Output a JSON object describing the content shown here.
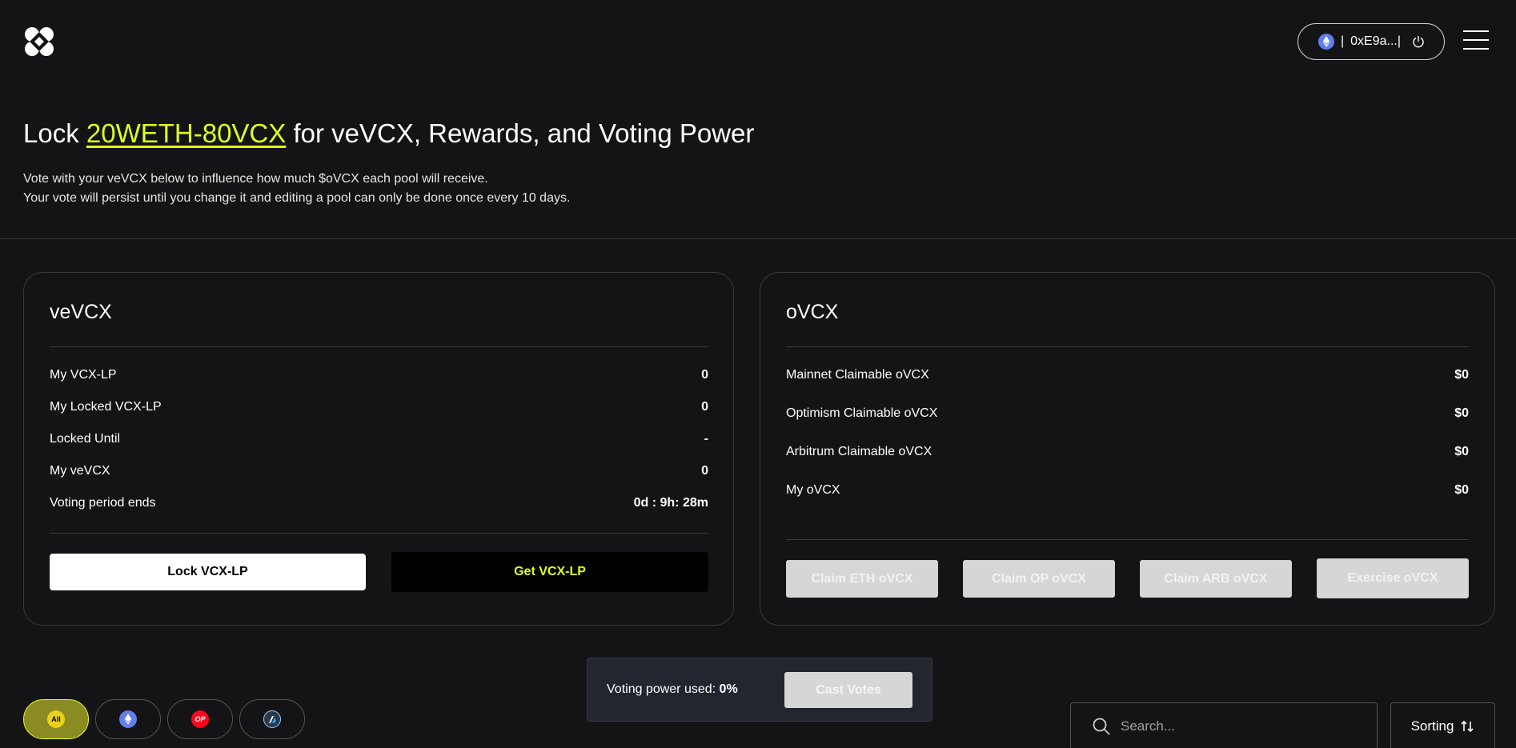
{
  "header": {
    "wallet": {
      "network_icon": "ethereum-icon",
      "separator": "|",
      "address": "0xE9a...|",
      "power_icon": "power-icon"
    },
    "menu_icon": "hamburger-menu-icon"
  },
  "hero": {
    "title_prefix": "Lock ",
    "title_lp": "20WETH-80VCX",
    "title_suffix": " for veVCX, Rewards, and Voting Power",
    "desc_line1": "Vote with your veVCX below to influence how much $oVCX each pool will receive.",
    "desc_line2": "Your vote will persist until you change it and editing a pool can only be done once every 10 days."
  },
  "vevcx_card": {
    "title": "veVCX",
    "rows": [
      {
        "label": "My VCX-LP",
        "value": "0"
      },
      {
        "label": "My Locked VCX-LP",
        "value": "0"
      },
      {
        "label": "Locked Until",
        "value": "-"
      },
      {
        "label": "My veVCX",
        "value": "0"
      },
      {
        "label": "Voting period ends",
        "value": "0d : 9h: 28m"
      }
    ],
    "lock_button": "Lock VCX-LP",
    "get_button": "Get VCX-LP"
  },
  "ovcx_card": {
    "title": "oVCX",
    "rows": [
      {
        "label": "Mainnet Claimable oVCX",
        "value": "$0"
      },
      {
        "label": "Optimism Claimable oVCX",
        "value": "$0"
      },
      {
        "label": "Arbitrum Claimable oVCX",
        "value": "$0"
      },
      {
        "label": "My oVCX",
        "value": "$0"
      }
    ],
    "buttons": [
      "Claim ETH oVCX",
      "Claim OP oVCX",
      "Claim ARB oVCX",
      "Exercise oVCX"
    ]
  },
  "voting": {
    "label": "Voting power used: ",
    "value": "0%",
    "cast_button": "Cast Votes"
  },
  "network_filters": [
    {
      "label": "All",
      "icon": "all-networks-icon",
      "active": true
    },
    {
      "label": "",
      "icon": "ethereum-icon",
      "active": false
    },
    {
      "label": "OP",
      "icon": "optimism-icon",
      "active": false
    },
    {
      "label": "",
      "icon": "arbitrum-icon",
      "active": false
    }
  ],
  "search": {
    "placeholder": "Search...",
    "icon": "search-icon"
  },
  "sorting": {
    "label": "Sorting",
    "icon": "sort-arrows-icon"
  },
  "colors": {
    "accent": "#dfff1c",
    "background": "#141416",
    "border": "#3a3a3e"
  }
}
